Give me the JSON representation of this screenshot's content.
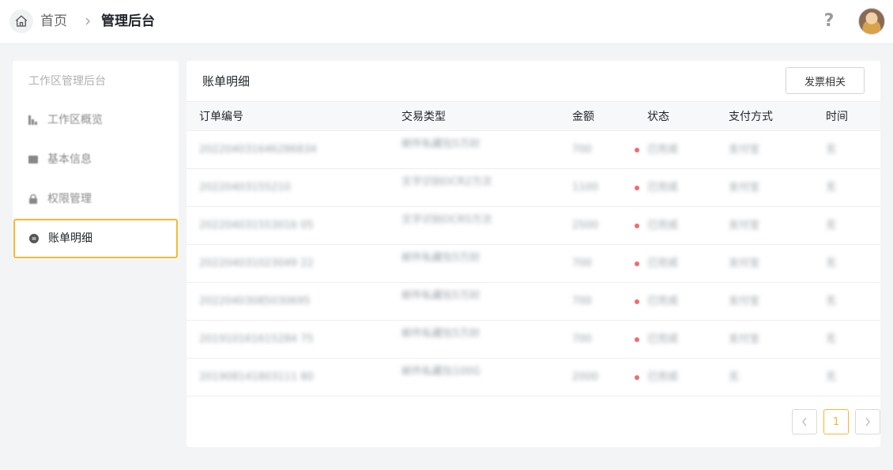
{
  "header": {
    "breadcrumb_home": "首页",
    "breadcrumb_current": "管理后台",
    "help_glyph": "?"
  },
  "sidebar": {
    "title": "工作区管理后台",
    "items": [
      {
        "label": "工作区概览",
        "icon": "bar-chart-icon"
      },
      {
        "label": "基本信息",
        "icon": "id-card-icon"
      },
      {
        "label": "权限管理",
        "icon": "lock-icon"
      },
      {
        "label": "账单明细",
        "icon": "coin-icon",
        "active": true
      }
    ]
  },
  "main": {
    "title": "账单明细",
    "invoice_button": "发票相关",
    "columns": [
      "订单编号",
      "交易类型",
      "金额",
      "状态",
      "支付方式",
      "时间"
    ],
    "rows": [
      {
        "id": "202204031646286834",
        "type": "邮件私藏包5万封",
        "amount": "700",
        "status": "已完成",
        "payment": "支付宝",
        "time": "无"
      },
      {
        "id": "20220403155210",
        "type": "文字识别OCR2万次",
        "amount": "1100",
        "status": "已完成",
        "payment": "支付宝",
        "time": "无"
      },
      {
        "id": "202204031553016 05",
        "type": "文字识别OCR5万次",
        "amount": "2500",
        "status": "已完成",
        "payment": "支付宝",
        "time": "无"
      },
      {
        "id": "202204031023049 22",
        "type": "邮件私藏包5万封",
        "amount": "700",
        "status": "已完成",
        "payment": "支付宝",
        "time": "无"
      },
      {
        "id": "20220403085030695",
        "type": "邮件私藏包5万封",
        "amount": "700",
        "status": "已完成",
        "payment": "支付宝",
        "time": "无"
      },
      {
        "id": "201910161615284 75",
        "type": "邮件私藏包5万封",
        "amount": "700",
        "status": "已完成",
        "payment": "支付宝",
        "time": "无"
      },
      {
        "id": "201908141803111 80",
        "type": "邮件私藏包100G",
        "amount": "2000",
        "status": "已完成",
        "payment": "无",
        "time": "无"
      }
    ],
    "pagination": {
      "current_page": "1"
    }
  },
  "colors": {
    "accent": "#f5b731",
    "status_dot": "#f46a6a",
    "background": "#f3f4f6"
  }
}
